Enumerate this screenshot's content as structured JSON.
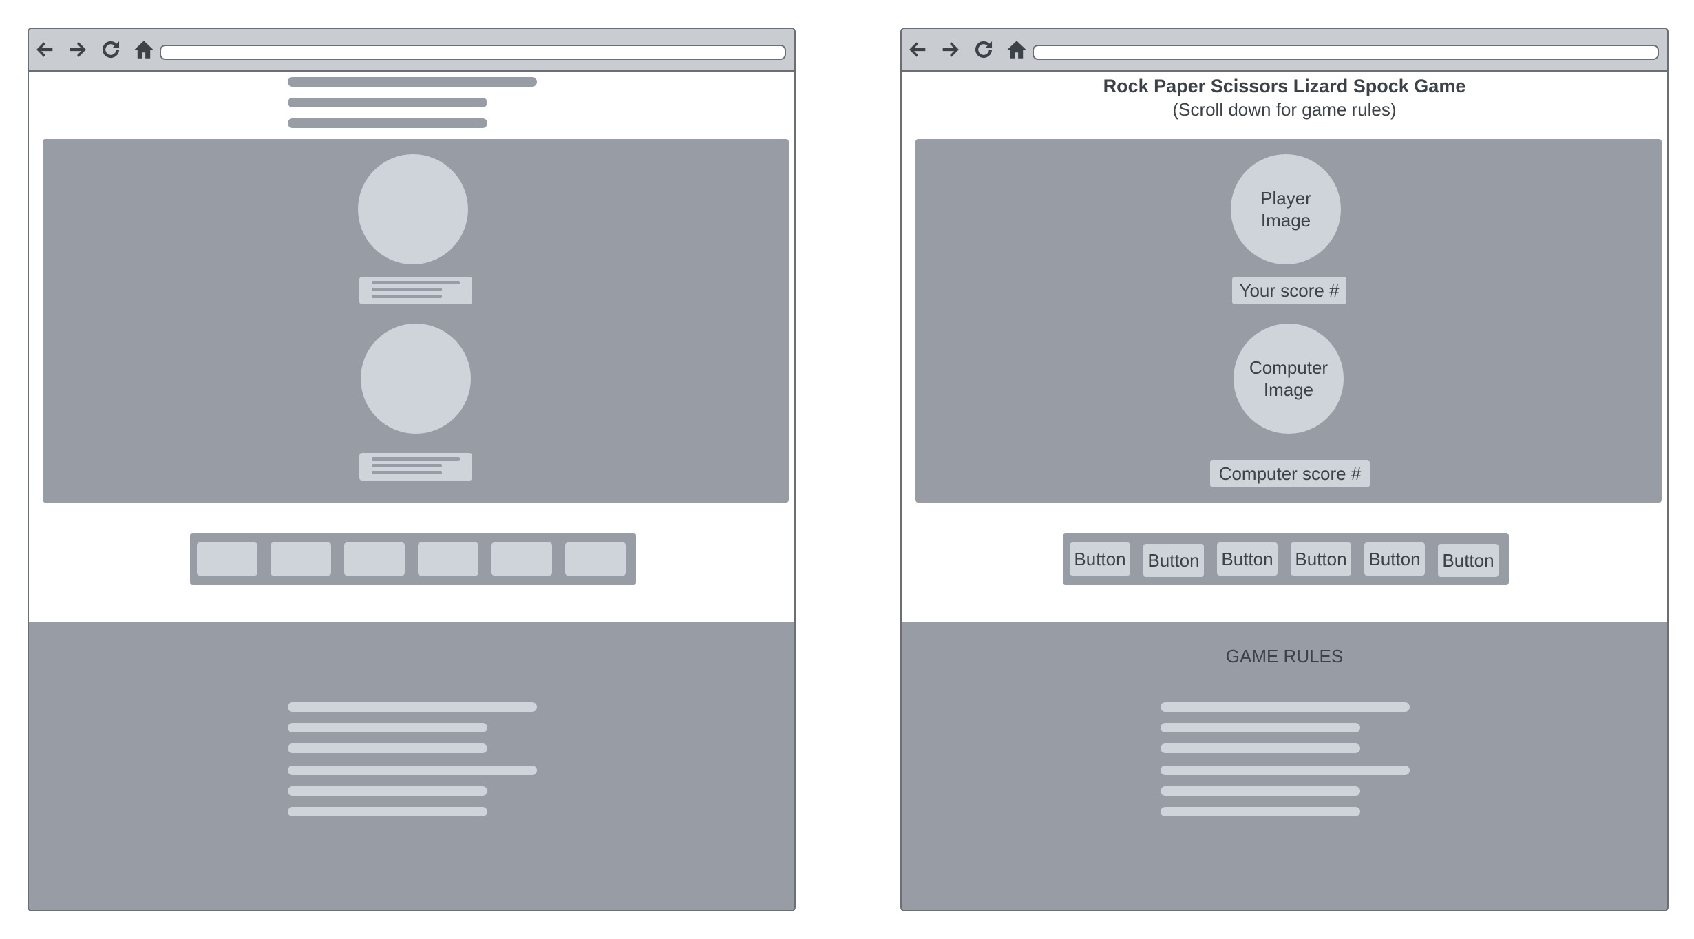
{
  "colors": {
    "stage": "#979ca5",
    "placeholder": "#cfd4db",
    "toolbar": "#c9ccd0",
    "text": "#3d4148",
    "frame": "#6b6f75"
  },
  "icons": [
    "back-arrow-icon",
    "forward-arrow-icon",
    "refresh-icon",
    "home-icon"
  ],
  "annotated": {
    "title": "Rock Paper Scissors Lizard Spock Game",
    "subtitle": "(Scroll down for game rules)",
    "player_image": "Player\nImage",
    "player_score": "Your score #",
    "computer_image": "Computer\nImage",
    "computer_score": "Computer score #",
    "buttons": [
      "Button",
      "Button",
      "Button",
      "Button",
      "Button",
      "Button"
    ],
    "rules_title": "GAME RULES"
  }
}
